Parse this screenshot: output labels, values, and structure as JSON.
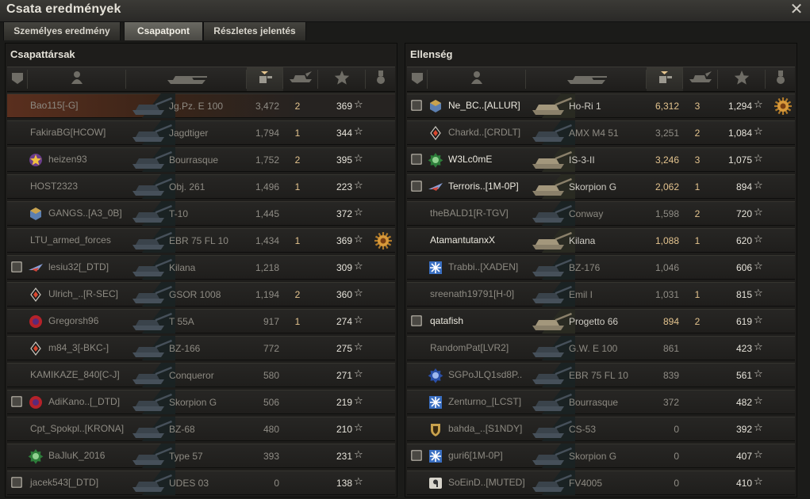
{
  "window": {
    "title": "Csata eredmények",
    "close_glyph": "✕"
  },
  "tabs": [
    {
      "label": "Személyes eredmény",
      "active": false
    },
    {
      "label": "Csapatpont",
      "active": true
    },
    {
      "label": "Részletes jelentés",
      "active": false
    }
  ],
  "columns": [
    "squad-icon",
    "player-icon",
    "tank-icon",
    "damage-icon",
    "kills-icon",
    "xp-star-icon",
    "medal-icon"
  ],
  "colors": {
    "self_row": "#5a2f1e",
    "highlight_value": "#e3c38e",
    "dim_text": "#8d8a82"
  },
  "allies": {
    "title": "Csapattársak",
    "rows": [
      {
        "name": "Bao115[-G]",
        "vehicle": "Jg.Pz. E 100",
        "damage": "3,472",
        "kills": "2",
        "xp": "369",
        "squad": "",
        "badge": "",
        "medal": false,
        "self": true,
        "dead": true
      },
      {
        "name": "FakiraBG[HCOW]",
        "vehicle": "Jagdtiger",
        "damage": "1,794",
        "kills": "1",
        "xp": "344",
        "squad": "",
        "badge": "",
        "medal": false,
        "self": false,
        "dead": true
      },
      {
        "name": "heizen93",
        "vehicle": "Bourrasque",
        "damage": "1,752",
        "kills": "2",
        "xp": "395",
        "squad": "",
        "badge": "star-badge-icon",
        "medal": false,
        "self": false,
        "dead": true
      },
      {
        "name": "HOST2323",
        "vehicle": "Obj. 261",
        "damage": "1,496",
        "kills": "1",
        "xp": "223",
        "squad": "",
        "badge": "",
        "medal": false,
        "self": false,
        "dead": true
      },
      {
        "name": "GANGS..[A3_0B]",
        "vehicle": "T-10",
        "damage": "1,445",
        "kills": "",
        "xp": "372",
        "squad": "",
        "badge": "cube-badge-icon",
        "medal": false,
        "self": false,
        "dead": true
      },
      {
        "name": "LTU_armed_forces",
        "vehicle": "EBR 75 FL 10",
        "damage": "1,434",
        "kills": "1",
        "xp": "369",
        "squad": "",
        "badge": "",
        "medal": true,
        "self": false,
        "dead": true
      },
      {
        "name": "lesiu32[_DTD]",
        "vehicle": "Kilana",
        "damage": "1,218",
        "kills": "",
        "xp": "309",
        "squad": "1",
        "badge": "plane-badge-icon",
        "medal": false,
        "self": false,
        "dead": true
      },
      {
        "name": "Ulrich_..[R-SEC]",
        "vehicle": "GSOR 1008",
        "damage": "1,194",
        "kills": "2",
        "xp": "360",
        "squad": "",
        "badge": "diamond-badge-icon",
        "medal": false,
        "self": false,
        "dead": true
      },
      {
        "name": "Gregorsh96",
        "vehicle": "T 55A",
        "damage": "917",
        "kills": "1",
        "xp": "274",
        "squad": "",
        "badge": "red-badge-icon",
        "medal": false,
        "self": false,
        "dead": true
      },
      {
        "name": "m84_3[-BKC-]",
        "vehicle": "BZ-166",
        "damage": "772",
        "kills": "",
        "xp": "275",
        "squad": "",
        "badge": "diamond-badge-icon",
        "medal": false,
        "self": false,
        "dead": true
      },
      {
        "name": "KAMIKAZE_840[C-J]",
        "vehicle": "Conqueror",
        "damage": "580",
        "kills": "",
        "xp": "271",
        "squad": "",
        "badge": "",
        "medal": false,
        "self": false,
        "dead": true
      },
      {
        "name": "AdiKano..[_DTD]",
        "vehicle": "Skorpion G",
        "damage": "506",
        "kills": "",
        "xp": "219",
        "squad": "1",
        "badge": "red-badge-icon",
        "medal": false,
        "self": false,
        "dead": true
      },
      {
        "name": "Cpt_Spokpl..[KRONA]",
        "vehicle": "BZ-68",
        "damage": "480",
        "kills": "",
        "xp": "210",
        "squad": "",
        "badge": "",
        "medal": false,
        "self": false,
        "dead": true
      },
      {
        "name": "BaJluK_2016",
        "vehicle": "Type 57",
        "damage": "393",
        "kills": "",
        "xp": "231",
        "squad": "",
        "badge": "green-badge-icon",
        "medal": false,
        "self": false,
        "dead": true
      },
      {
        "name": "jacek543[_DTD]",
        "vehicle": "UDES 03",
        "damage": "0",
        "kills": "",
        "xp": "138",
        "squad": "1",
        "badge": "",
        "medal": false,
        "self": false,
        "dead": true
      }
    ]
  },
  "enemies": {
    "title": "Ellenség",
    "rows": [
      {
        "name": "Ne_BC..[ALLUR]",
        "vehicle": "Ho-Ri 1",
        "damage": "6,312",
        "kills": "3",
        "xp": "1,294",
        "squad": "1",
        "badge": "cube-badge-icon",
        "medal": true,
        "dead": false
      },
      {
        "name": "Charkd..[CRDLT]",
        "vehicle": "AMX M4 51",
        "damage": "3,251",
        "kills": "2",
        "xp": "1,084",
        "squad": "",
        "badge": "diamond-badge-icon",
        "medal": false,
        "dead": true
      },
      {
        "name": "W3Lc0mE",
        "vehicle": "IS-3-II",
        "damage": "3,246",
        "kills": "3",
        "xp": "1,075",
        "squad": "1",
        "badge": "green-badge-icon",
        "medal": false,
        "dead": false
      },
      {
        "name": "Terroris..[1M-0P]",
        "vehicle": "Skorpion G",
        "damage": "2,062",
        "kills": "1",
        "xp": "894",
        "squad": "2",
        "badge": "plane-badge-icon",
        "medal": false,
        "dead": false
      },
      {
        "name": "theBALD1[R-TGV]",
        "vehicle": "Conway",
        "damage": "1,598",
        "kills": "2",
        "xp": "720",
        "squad": "",
        "badge": "",
        "medal": false,
        "dead": true
      },
      {
        "name": "AtamantutanxX",
        "vehicle": "Kilana",
        "damage": "1,088",
        "kills": "1",
        "xp": "620",
        "squad": "",
        "badge": "",
        "medal": false,
        "dead": false
      },
      {
        "name": "Trabbi..[XADEN]",
        "vehicle": "BZ-176",
        "damage": "1,046",
        "kills": "",
        "xp": "606",
        "squad": "",
        "badge": "snow-badge-icon",
        "medal": false,
        "dead": true
      },
      {
        "name": "sreenath19791[H-0]",
        "vehicle": "Emil I",
        "damage": "1,031",
        "kills": "1",
        "xp": "815",
        "squad": "",
        "badge": "",
        "medal": false,
        "dead": true
      },
      {
        "name": "qatafish",
        "vehicle": "Progetto 66",
        "damage": "894",
        "kills": "2",
        "xp": "619",
        "squad": "1",
        "badge": "",
        "medal": false,
        "dead": false
      },
      {
        "name": "RandomPat[LVR2]",
        "vehicle": "G.W. E 100",
        "damage": "861",
        "kills": "",
        "xp": "423",
        "squad": "",
        "badge": "",
        "medal": false,
        "dead": true
      },
      {
        "name": "SGPoJLQ1sd8P..",
        "vehicle": "EBR 75 FL 10",
        "damage": "839",
        "kills": "",
        "xp": "561",
        "squad": "",
        "badge": "blue-badge-icon",
        "medal": false,
        "dead": true
      },
      {
        "name": "Zenturno_[LCST]",
        "vehicle": "Bourrasque",
        "damage": "372",
        "kills": "",
        "xp": "482",
        "squad": "",
        "badge": "snow-badge-icon",
        "medal": false,
        "dead": true
      },
      {
        "name": "bahda_..[S1NDY]",
        "vehicle": "CS-53",
        "damage": "0",
        "kills": "",
        "xp": "392",
        "squad": "",
        "badge": "shield-badge-icon",
        "medal": false,
        "dead": true
      },
      {
        "name": "guri6[1M-0P]",
        "vehicle": "Skorpion G",
        "damage": "0",
        "kills": "",
        "xp": "407",
        "squad": "2",
        "badge": "snow-badge-icon",
        "medal": false,
        "dead": true
      },
      {
        "name": "SoEinD..[MUTED]",
        "vehicle": "FV4005",
        "damage": "0",
        "kills": "",
        "xp": "410",
        "squad": "",
        "badge": "nine-badge-icon",
        "medal": false,
        "dead": true
      }
    ]
  }
}
